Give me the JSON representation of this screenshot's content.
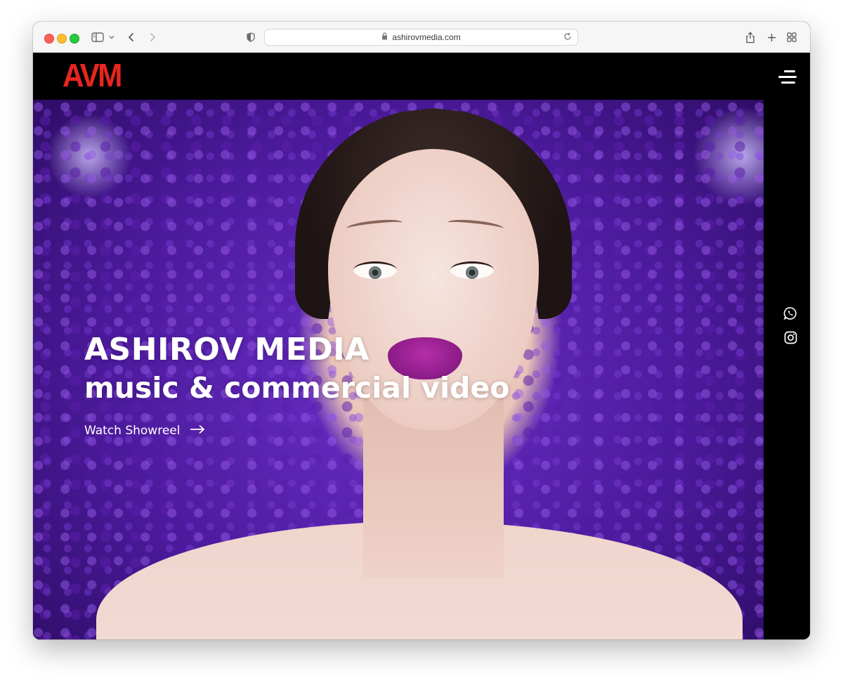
{
  "browser": {
    "url": "ashirovmedia.com"
  },
  "site": {
    "logo": "AVM",
    "hero": {
      "title": "ASHIROV MEDIA",
      "subtitle": "music & commercial video",
      "cta_label": "Watch Showreel"
    }
  },
  "icons": {
    "menu": "hamburger-menu-icon",
    "social": [
      "whatsapp-icon",
      "instagram-icon"
    ],
    "cta": "arrow-right-icon"
  },
  "colors": {
    "logo": "#e8251f",
    "header_bg": "#000000",
    "hero_text": "#ffffff",
    "lips": "#a0249b"
  }
}
